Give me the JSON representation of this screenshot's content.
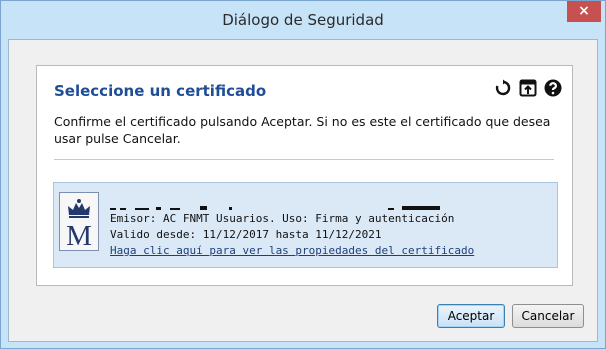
{
  "window": {
    "title": "Diálogo de Seguridad",
    "close_label": "×"
  },
  "panel": {
    "heading": "Seleccione un certificado",
    "instructions": "Confirme el certificado pulsando Aceptar. Si no es este el certificado que desea usar pulse Cancelar.",
    "icons": [
      "refresh-icon",
      "open-window-icon",
      "help-icon"
    ]
  },
  "certificate": {
    "logo_letter": "M",
    "issuer_line": "Emisor: AC FNMT Usuarios. Uso: Firma y autenticación",
    "validity_line": "Valido desde: 11/12/2017 hasta 11/12/2021",
    "properties_link": "Haga clic aquí para ver las propiedades del certificado"
  },
  "buttons": {
    "accept": "Aceptar",
    "cancel": "Cancelar"
  },
  "colors": {
    "heading": "#1f4e96",
    "cert_background": "#dbe9f7",
    "frame": "#c7e3f8",
    "close": "#c75050"
  }
}
